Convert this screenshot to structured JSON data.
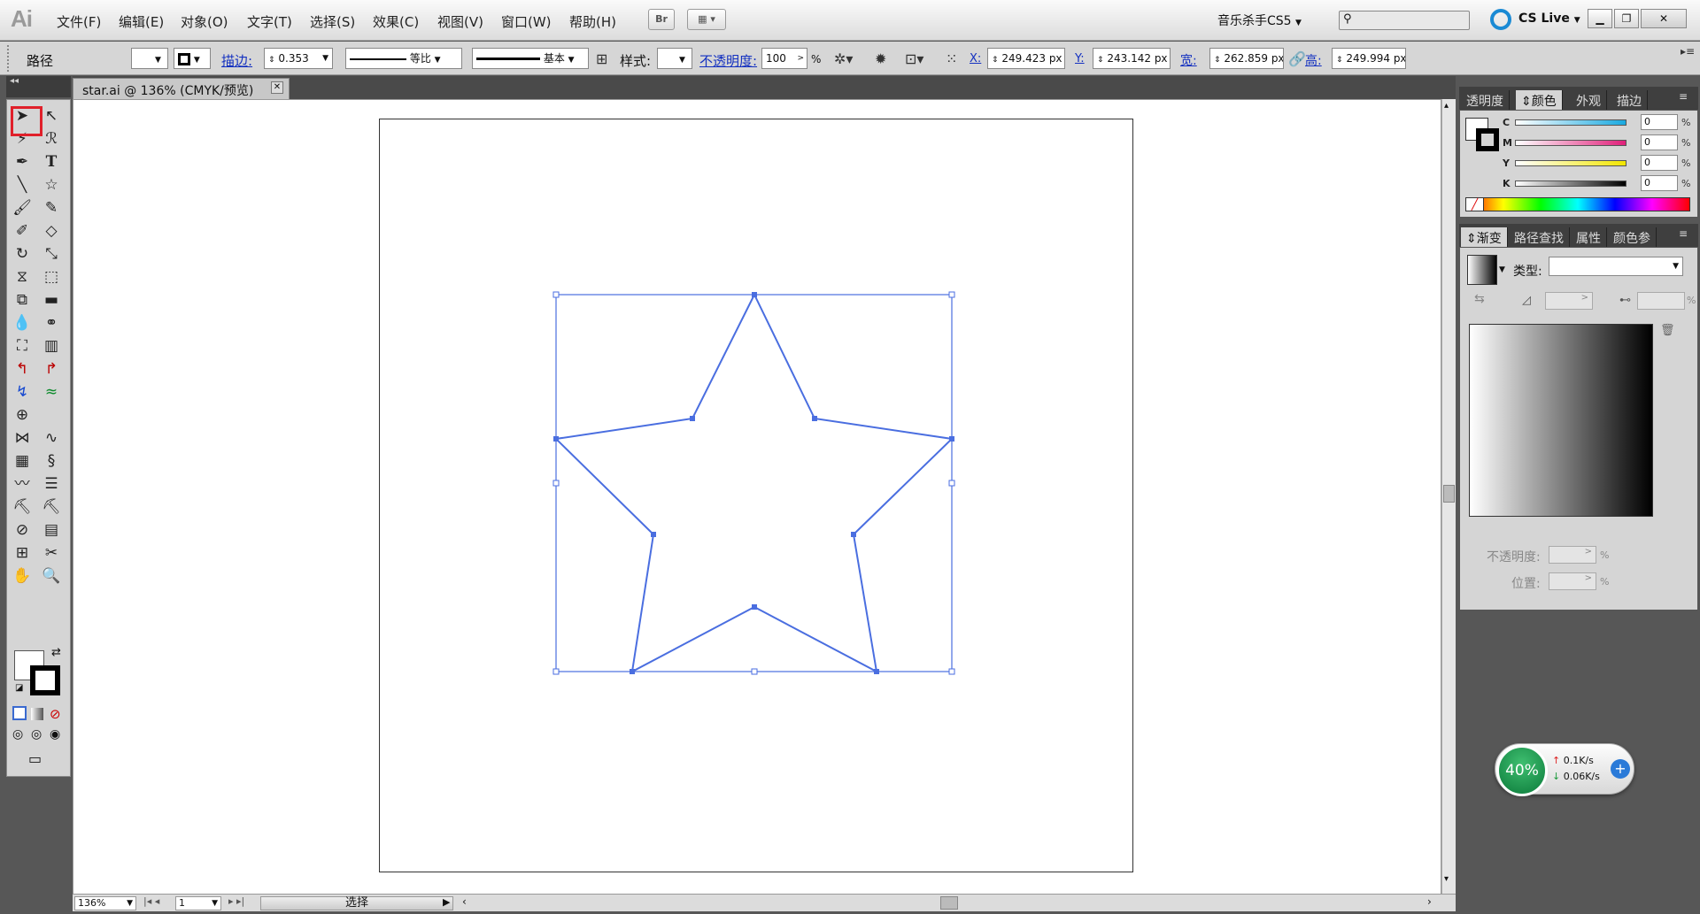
{
  "app": {
    "logo": "Ai"
  },
  "menu": {
    "items": [
      "文件(F)",
      "编辑(E)",
      "对象(O)",
      "文字(T)",
      "选择(S)",
      "效果(C)",
      "视图(V)",
      "窗口(W)",
      "帮助(H)"
    ]
  },
  "topbar": {
    "bridge_label": "Br",
    "workspace": "音乐杀手CS5",
    "cslive": "CS Live"
  },
  "control": {
    "object_type": "路径",
    "stroke_label": "描边:",
    "stroke_weight": "0.353",
    "profile_label": "等比",
    "brush_label": "基本",
    "style_label": "样式:",
    "opacity_label": "不透明度:",
    "opacity_value": "100",
    "opacity_unit": "%",
    "x_label": "X:",
    "x_value": "249.423 px",
    "y_label": "Y:",
    "y_value": "243.142 px",
    "w_label": "宽:",
    "w_value": "262.859 px",
    "h_label": "高:",
    "h_value": "249.994 px"
  },
  "document": {
    "tab_title": "star.ai @ 136% (CMYK/预览)"
  },
  "status": {
    "zoom": "136%",
    "page": "1",
    "mode": "选择"
  },
  "color_panel": {
    "tabs": [
      "透明度",
      "颜色",
      "外观",
      "描边"
    ],
    "active_tab": "颜色",
    "channels": [
      {
        "label": "C",
        "value": "0",
        "color": "#19a9e0"
      },
      {
        "label": "M",
        "value": "0",
        "color": "#e0207a"
      },
      {
        "label": "Y",
        "value": "0",
        "color": "#f2e600"
      },
      {
        "label": "K",
        "value": "0",
        "color": "#000000"
      }
    ],
    "unit": "%"
  },
  "gradient_panel": {
    "tabs": [
      "渐变",
      "路径查找",
      "属性",
      "颜色参考"
    ],
    "tab_display": [
      "渐变",
      "路径查找",
      "属性",
      "颜色参"
    ],
    "active_tab": "渐变",
    "type_label": "类型:",
    "opacity_label": "不透明度:",
    "location_label": "位置:",
    "unit": "%"
  },
  "network_widget": {
    "percent": "40%",
    "upload": "0.1K/s",
    "download": "0.06K/s"
  },
  "colors": {
    "selection": "#4a6ee0",
    "highlight": "#e0202a",
    "panel_bg": "#d5d5d5"
  }
}
